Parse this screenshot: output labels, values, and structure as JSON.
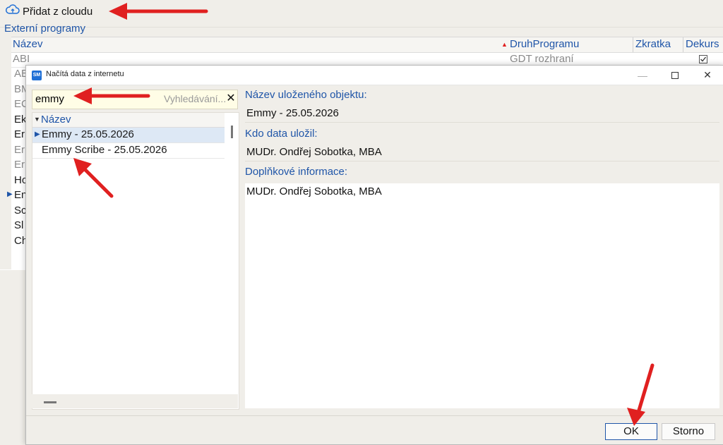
{
  "background": {
    "toolbar": {
      "add_from_cloud_label": "Přidat z cloudu"
    },
    "section_title": "Externí programy",
    "columns": {
      "name": "Název",
      "program_type": "DruhProgramu",
      "shortcut": "Zkratka",
      "dekurs": "Dekurs"
    },
    "rows": [
      {
        "name": "ABI",
        "type": "GDT rozhraní"
      },
      {
        "name": "AB",
        "type": ""
      },
      {
        "name": "BM",
        "type": ""
      },
      {
        "name": "EC",
        "type": ""
      },
      {
        "name": "Ek",
        "type": ""
      },
      {
        "name": "Er",
        "type": ""
      },
      {
        "name": "Er",
        "type": ""
      },
      {
        "name": "Er",
        "type": ""
      },
      {
        "name": "Ho",
        "type": ""
      },
      {
        "name": "En",
        "type": ""
      },
      {
        "name": "Sc",
        "type": ""
      },
      {
        "name": "Sl",
        "type": ""
      },
      {
        "name": "Ch",
        "type": ""
      }
    ]
  },
  "dialog": {
    "title": "Načítá data z internetu",
    "app_icon_text": "SM",
    "search": {
      "value": "emmy",
      "placeholder": "Vyhledávání..."
    },
    "list": {
      "column_name": "Název",
      "items": [
        "Emmy - 25.05.2026",
        "Emmy Scribe - 25.05.2026"
      ]
    },
    "details": {
      "object_name_label": "Název uloženého objektu:",
      "object_name_value": "Emmy - 25.05.2026",
      "saved_by_label": "Kdo data uložil:",
      "saved_by_value": "MUDr. Ondřej Sobotka, MBA",
      "additional_info_label": "Doplňkové informace:",
      "additional_info_value": "MUDr. Ondřej Sobotka, MBA"
    },
    "buttons": {
      "ok": "OK",
      "cancel": "Storno"
    }
  },
  "colors": {
    "accent": "#1f55a8",
    "annotation_arrow": "#e02020"
  }
}
